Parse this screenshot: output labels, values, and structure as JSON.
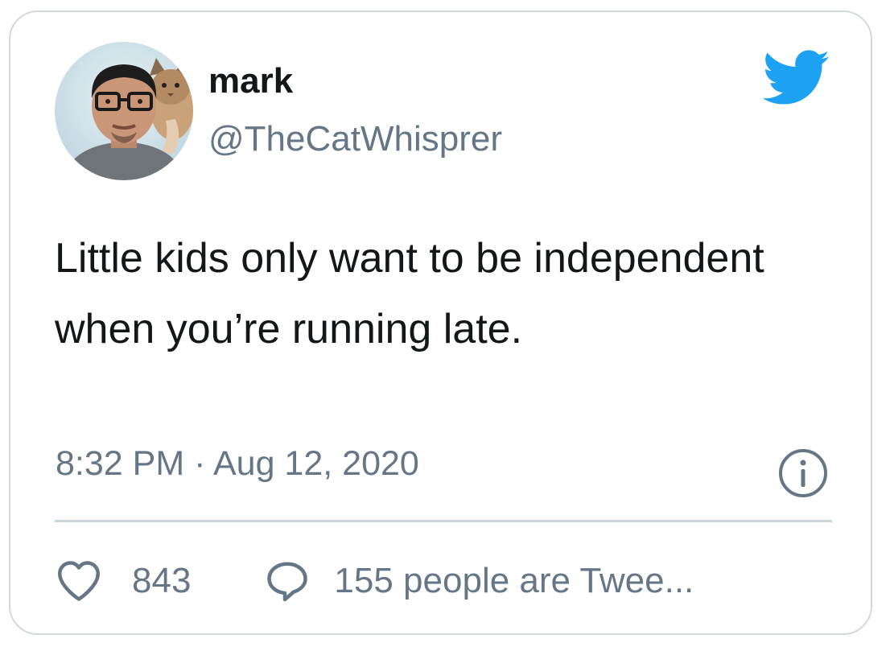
{
  "author": {
    "name": "mark",
    "handle": "@TheCatWhisprer"
  },
  "tweet": {
    "text": "Little kids only want to be independent when you’re running late.",
    "timestamp": "8:32 PM · Aug 12, 2020"
  },
  "engagement": {
    "likes": "843",
    "conversation": "155 people are Twee..."
  },
  "icons": {
    "brand": "twitter-bird-icon",
    "info": "info-icon",
    "like": "heart-icon",
    "reply": "speech-bubble-icon"
  },
  "colors": {
    "brand": "#1da1f2",
    "primary_text": "#14171a",
    "secondary_text": "#657786",
    "border": "#d4d9de",
    "divider": "#ccd6dd"
  }
}
